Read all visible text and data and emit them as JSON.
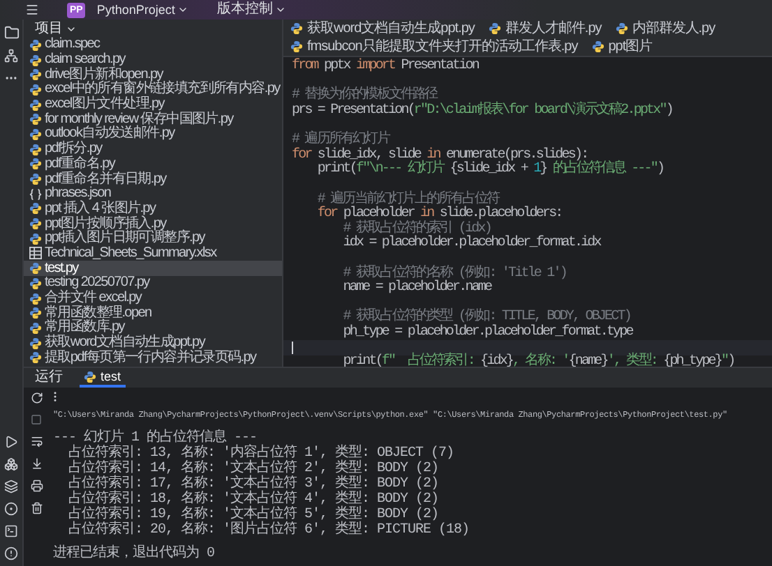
{
  "title_bar": {
    "project_badge": "PP",
    "project": "PythonProject",
    "vcs": "版本控制"
  },
  "project_panel": {
    "title": "项目",
    "files": [
      {
        "name": "claim.spec",
        "kind": "python",
        "selected": false
      },
      {
        "name": "claim search.py",
        "kind": "python",
        "selected": false
      },
      {
        "name": "drive图片新和open.py",
        "kind": "python",
        "selected": false
      },
      {
        "name": "excel中的所有窗外链接填充到所有内容.py",
        "kind": "python",
        "selected": false
      },
      {
        "name": "excel图片文件处理.py",
        "kind": "python",
        "selected": false
      },
      {
        "name": "for monthly review 保存中国图片.py",
        "kind": "python",
        "selected": false
      },
      {
        "name": "outlook自动发送邮件.py",
        "kind": "python",
        "selected": false
      },
      {
        "name": "pdf拆分.py",
        "kind": "python",
        "selected": false
      },
      {
        "name": "pdf重命名.py",
        "kind": "python",
        "selected": false
      },
      {
        "name": "pdf重命名并有日期.py",
        "kind": "python",
        "selected": false
      },
      {
        "name": "phrases.json",
        "kind": "json",
        "selected": false
      },
      {
        "name": "ppt 插入 4 张图片.py",
        "kind": "python",
        "selected": false
      },
      {
        "name": "ppt图片按顺序插入.py",
        "kind": "python",
        "selected": false
      },
      {
        "name": "ppt插入图片日期可调整序.py",
        "kind": "python",
        "selected": false
      },
      {
        "name": "Technical_Sheets_Summary.xlsx",
        "kind": "spreadsheet",
        "selected": false
      },
      {
        "name": "test.py",
        "kind": "python",
        "selected": true
      },
      {
        "name": "testing 20250707.py",
        "kind": "python",
        "selected": false
      },
      {
        "name": "合并文件 excel.py",
        "kind": "python",
        "selected": false
      },
      {
        "name": "常用函数整理.open",
        "kind": "python",
        "selected": false
      },
      {
        "name": "常用函数库.py",
        "kind": "python",
        "selected": false
      },
      {
        "name": "获取word文档自动生成ppt.py",
        "kind": "python",
        "selected": false
      },
      {
        "name": "提取pdf每页第一行内容并记录页码.py",
        "kind": "python",
        "selected": false
      }
    ]
  },
  "editor": {
    "tabs": [
      {
        "label": "获取word文档自动生成ppt.py",
        "selected": false
      },
      {
        "label": "群发人才邮件.py",
        "selected": false
      },
      {
        "label": "内部群发人.py",
        "selected": false
      },
      {
        "label": "fmsubcon只能提取文件夹打开的活动工作表.py",
        "selected": false
      },
      {
        "label": "ppt图片",
        "selected": false
      }
    ],
    "lines": [
      {
        "kind": "code",
        "current": false,
        "tokens": [
          {
            "text": "from",
            "kind": "keyword"
          },
          {
            "text": " pptx ",
            "kind": "plain"
          },
          {
            "text": "import",
            "kind": "keyword"
          },
          {
            "text": " Presentation",
            "kind": "plain"
          }
        ]
      },
      {
        "kind": "blank",
        "current": false
      },
      {
        "kind": "code",
        "current": false,
        "tokens": [
          {
            "text": "# 替换为你的模板文件路径",
            "kind": "comment"
          }
        ]
      },
      {
        "kind": "code",
        "current": false,
        "tokens": [
          {
            "text": "prs = Presentation(",
            "kind": "plain"
          },
          {
            "text": "r\"D:\\claim报表\\for board\\演示文稿2.pptx\"",
            "kind": "string"
          },
          {
            "text": ")",
            "kind": "plain"
          }
        ]
      },
      {
        "kind": "blank",
        "current": false
      },
      {
        "kind": "code",
        "current": false,
        "tokens": [
          {
            "text": "# 遍历所有幻灯片",
            "kind": "comment"
          }
        ]
      },
      {
        "kind": "code",
        "current": false,
        "tokens": [
          {
            "text": "for",
            "kind": "keyword"
          },
          {
            "text": " slide_idx, slide ",
            "kind": "plain"
          },
          {
            "text": "in",
            "kind": "keyword"
          },
          {
            "text": " enumerate(prs.slides):",
            "kind": "plain"
          }
        ]
      },
      {
        "kind": "code",
        "current": false,
        "tokens": [
          {
            "text": "    print(",
            "kind": "plain"
          },
          {
            "text": "f\"\\n--- 幻灯片 ",
            "kind": "string"
          },
          {
            "text": "{slide_idx + ",
            "kind": "plain"
          },
          {
            "text": "1",
            "kind": "number"
          },
          {
            "text": "}",
            "kind": "plain"
          },
          {
            "text": " 的占位符信息 ---\"",
            "kind": "string"
          },
          {
            "text": ")",
            "kind": "plain"
          }
        ]
      },
      {
        "kind": "blank",
        "current": false
      },
      {
        "kind": "code",
        "current": false,
        "tokens": [
          {
            "text": "    # 遍历当前幻灯片上的所有占位符",
            "kind": "comment"
          }
        ]
      },
      {
        "kind": "code",
        "current": false,
        "tokens": [
          {
            "text": "    for",
            "kind": "keyword"
          },
          {
            "text": " placeholder ",
            "kind": "plain"
          },
          {
            "text": "in",
            "kind": "keyword"
          },
          {
            "text": " slide.placeholders:",
            "kind": "plain"
          }
        ]
      },
      {
        "kind": "code",
        "current": false,
        "tokens": [
          {
            "text": "        # 获取占位符的索引 (idx)",
            "kind": "comment"
          }
        ]
      },
      {
        "kind": "code",
        "current": false,
        "tokens": [
          {
            "text": "        idx = placeholder.placeholder_format.idx",
            "kind": "plain"
          }
        ]
      },
      {
        "kind": "blank",
        "current": false
      },
      {
        "kind": "code",
        "current": false,
        "tokens": [
          {
            "text": "        # 获取占位符的名称 (例如: 'Title 1')",
            "kind": "comment"
          }
        ]
      },
      {
        "kind": "code",
        "current": false,
        "tokens": [
          {
            "text": "        name = placeholder.name",
            "kind": "plain"
          }
        ]
      },
      {
        "kind": "blank",
        "current": false
      },
      {
        "kind": "code",
        "current": false,
        "tokens": [
          {
            "text": "        # 获取占位符的类型 (例如: TITLE, BODY, OBJECT)",
            "kind": "comment"
          }
        ]
      },
      {
        "kind": "code",
        "current": false,
        "tokens": [
          {
            "text": "        ph_type = placeholder.placeholder_format.type",
            "kind": "plain"
          }
        ]
      },
      {
        "kind": "blank",
        "current": true
      },
      {
        "kind": "code",
        "current": false,
        "tokens": [
          {
            "text": "        print(",
            "kind": "plain"
          },
          {
            "text": "f\"  占位符索引: ",
            "kind": "string"
          },
          {
            "text": "{idx}",
            "kind": "plain"
          },
          {
            "text": ", 名称: '",
            "kind": "string"
          },
          {
            "text": "{name}",
            "kind": "plain"
          },
          {
            "text": "', 类型: ",
            "kind": "string"
          },
          {
            "text": "{ph_type}",
            "kind": "plain"
          },
          {
            "text": "\"",
            "kind": "string"
          },
          {
            "text": ")",
            "kind": "plain"
          }
        ]
      }
    ]
  },
  "run_panel": {
    "title": "运行",
    "tabs": [
      {
        "label": "test",
        "selected": true
      }
    ],
    "output": [
      {
        "kind": "command",
        "text": "\"C:\\Users\\Miranda Zhang\\PycharmProjects\\PythonProject\\.venv\\Scripts\\python.exe\" \"C:\\Users\\Miranda Zhang\\PycharmProjects\\PythonProject\\test.py\""
      },
      {
        "kind": "blank"
      },
      {
        "kind": "text",
        "text": "--- 幻灯片 1 的占位符信息 ---"
      },
      {
        "kind": "text",
        "text": "  占位符索引: 13, 名称: '内容占位符 1', 类型: OBJECT (7)"
      },
      {
        "kind": "text",
        "text": "  占位符索引: 14, 名称: '文本占位符 2', 类型: BODY (2)"
      },
      {
        "kind": "text",
        "text": "  占位符索引: 17, 名称: '文本占位符 3', 类型: BODY (2)"
      },
      {
        "kind": "text",
        "text": "  占位符索引: 18, 名称: '文本占位符 4', 类型: BODY (2)"
      },
      {
        "kind": "text",
        "text": "  占位符索引: 19, 名称: '文本占位符 5', 类型: BODY (2)"
      },
      {
        "kind": "text",
        "text": "  占位符索引: 20, 名称: '图片占位符 6', 类型: PICTURE (18)"
      },
      {
        "kind": "blank"
      },
      {
        "kind": "text",
        "text": "进程已结束，退出代码为 0"
      }
    ]
  }
}
